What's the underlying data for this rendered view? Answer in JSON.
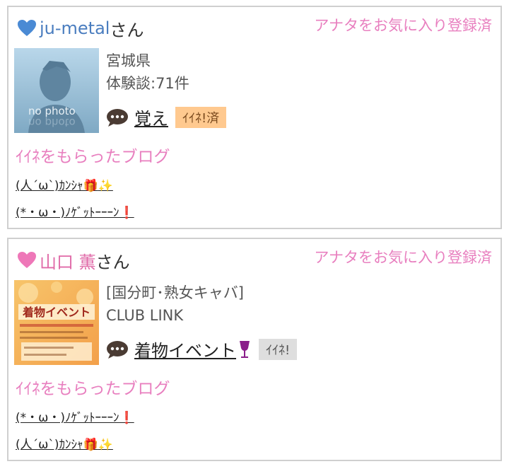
{
  "cards": [
    {
      "name": "ju-metal",
      "name_color": "#4a7dbf",
      "heart_color": "#4a8ad4",
      "honorific": "さん",
      "fav_status": "アナタをお気に入り登録済",
      "thumb_text": "no photo",
      "info_line1": "宮城県",
      "info_line2": "体験談:71件",
      "blog_title": "覚え",
      "blog_icon": "",
      "iine_label": "ｲｲﾈ!済",
      "liked_heading": "ｲｲﾈをもらったブログ",
      "liked_items": [
        {
          "text": "(人´ω`)ｶﾝｼｬ",
          "icons": "gift-sparkle"
        },
        {
          "text": "(*・ω・)ﾉｹﾞｯﾄｰｰｰﾝ",
          "icons": "exclamation"
        }
      ]
    },
    {
      "name": "山口 薫",
      "name_color": "#e06aa8",
      "heart_color": "#ee77b8",
      "honorific": "さん",
      "fav_status": "アナタをお気に入り登録済",
      "thumb_text": "着物イベント",
      "info_line1": "[国分町･熟女キャバ]",
      "info_line2": "CLUB LINK",
      "blog_title": "着物イベント",
      "blog_icon": "wine-glass",
      "iine_label": "ｲｲﾈ!",
      "liked_heading": "ｲｲﾈをもらったブログ",
      "liked_items": [
        {
          "text": "(*・ω・)ﾉｹﾞｯﾄｰｰｰﾝ",
          "icons": "exclamation"
        },
        {
          "text": "(人´ω`)ｶﾝｼｬ",
          "icons": "gift-sparkle"
        }
      ]
    }
  ]
}
